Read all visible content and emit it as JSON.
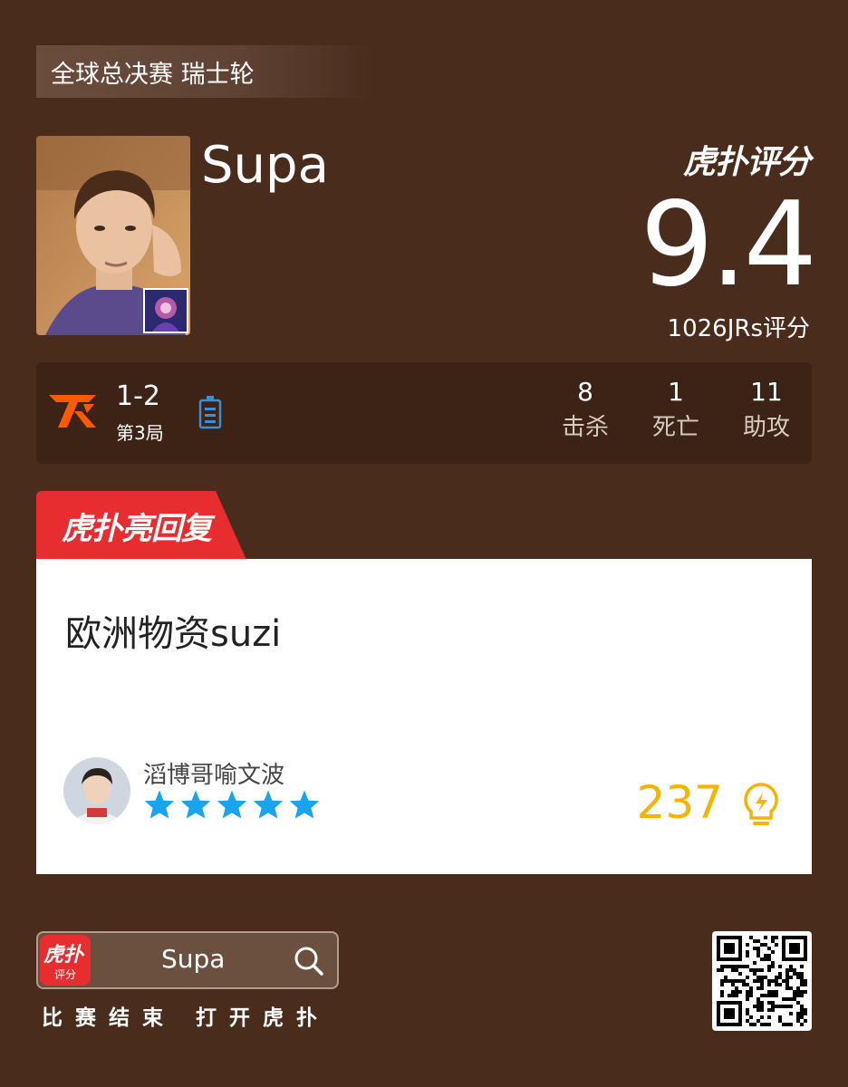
{
  "event": {
    "tag": "全球总决赛 瑞士轮"
  },
  "player": {
    "name": "Supa"
  },
  "rating": {
    "brand_label": "虎扑评分",
    "score": "9.4",
    "count_text": "1026JRs评分"
  },
  "match": {
    "score": "1-2",
    "game": "第3局",
    "stats": [
      {
        "value": "8",
        "label": "击杀"
      },
      {
        "value": "1",
        "label": "死亡"
      },
      {
        "value": "11",
        "label": "助攻"
      }
    ]
  },
  "reply": {
    "tab_label": "虎扑亮回复",
    "text": "欧洲物资suzi",
    "commenter": "滔博哥喻文波",
    "stars": 5,
    "likes": "237"
  },
  "footer": {
    "app_icon_text": "虎扑",
    "app_icon_sub": "评分",
    "search_text": "Supa",
    "caption": "比赛结束  打开虎扑"
  },
  "colors": {
    "background": "#4a2c1d",
    "accent_red": "#e82d30",
    "likes_gold": "#f5b301",
    "star_blue": "#1aa3ee",
    "team_orange": "#ff5a00"
  }
}
